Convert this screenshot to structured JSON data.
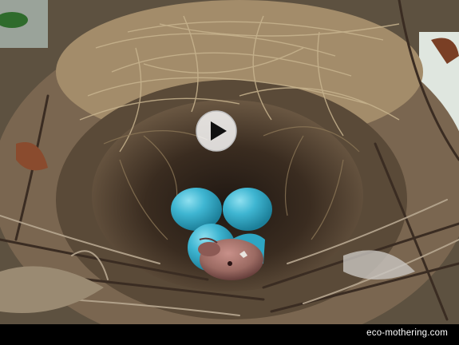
{
  "video": {
    "scene": "bird-nest-with-blue-eggs-and-hatchling",
    "play_icon": "play-icon",
    "watermark": "eco-mothering.com"
  },
  "colors": {
    "egg": "#3fb6d2",
    "nest_straw": "#b9a27c",
    "nest_dark": "#3a2c20",
    "hatchling": "#9b6a62",
    "bar": "#000000"
  }
}
